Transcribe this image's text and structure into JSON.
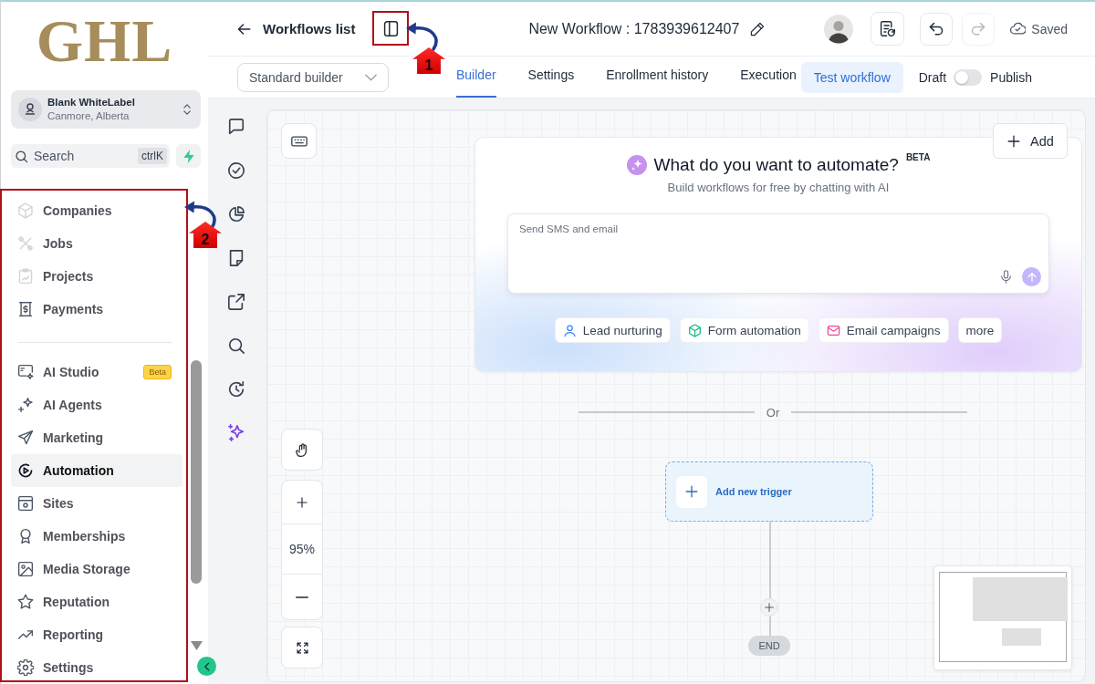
{
  "sidebar": {
    "logo": "GHL",
    "account": {
      "name": "Blank WhiteLabel",
      "location": "Canmore, Alberta"
    },
    "search": {
      "placeholder": "Search",
      "shortcut": "ctrlK"
    },
    "nav_sections": [
      {
        "items": [
          {
            "label": "Companies",
            "selected": false
          },
          {
            "label": "Jobs",
            "selected": false
          },
          {
            "label": "Projects",
            "selected": false
          },
          {
            "label": "Payments",
            "selected": false
          }
        ]
      },
      {
        "items": [
          {
            "label": "AI Studio",
            "badge": "Beta",
            "selected": false
          },
          {
            "label": "AI Agents",
            "selected": false
          },
          {
            "label": "Marketing",
            "selected": false
          },
          {
            "label": "Automation",
            "selected": true
          },
          {
            "label": "Sites",
            "selected": false
          },
          {
            "label": "Memberships",
            "selected": false
          },
          {
            "label": "Media Storage",
            "selected": false
          },
          {
            "label": "Reputation",
            "selected": false
          },
          {
            "label": "Reporting",
            "selected": false
          },
          {
            "label": "Settings",
            "selected": false
          }
        ]
      }
    ]
  },
  "header": {
    "back_link": "Workflows list",
    "title": "New Workflow : 1783939612407",
    "history_buttons": [
      {
        "disabled": false
      },
      {
        "disabled": true
      }
    ],
    "save_status": "Saved",
    "builder_select": {
      "value": "Standard builder"
    },
    "tabs": [
      {
        "label": "Builder",
        "selected": true
      },
      {
        "label": "Settings",
        "selected": false
      },
      {
        "label": "Enrollment history",
        "selected": false
      },
      {
        "label": "Execution",
        "selected": false
      }
    ],
    "test_button": "Test workflow",
    "publish": {
      "off_label": "Draft",
      "on_label": "Publish",
      "on": false
    }
  },
  "canvas": {
    "add_button": "Add",
    "ai_prompt": {
      "title": "What do you want to automate?",
      "badge": "BETA",
      "subtitle": "Build workflows for free by chatting with AI",
      "input": {
        "placeholder": "Send SMS and email"
      },
      "suggestions": [
        "Lead nurturing",
        "Form automation",
        "Email campaigns",
        "more"
      ]
    },
    "divider": "Or",
    "trigger": {
      "label": "Add new trigger"
    },
    "end_label": "END",
    "zoom": "95%"
  },
  "annotations": [
    {
      "number": "1"
    },
    {
      "number": "2"
    }
  ]
}
